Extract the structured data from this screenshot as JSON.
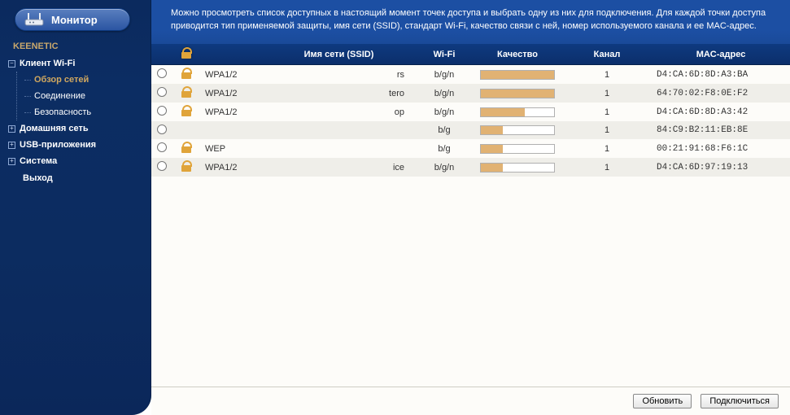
{
  "sidebar": {
    "title": "Монитор",
    "brand": "KEENETIC",
    "items": [
      {
        "label": "Клиент Wi-Fi",
        "expanded": true,
        "children": [
          {
            "label": "Обзор сетей",
            "selected": true
          },
          {
            "label": "Соединение"
          },
          {
            "label": "Безопасность"
          }
        ]
      },
      {
        "label": "Домашняя сеть",
        "expanded": false
      },
      {
        "label": "USB-приложения",
        "expanded": false
      },
      {
        "label": "Система",
        "expanded": false
      }
    ],
    "exit": "Выход"
  },
  "description": "Можно просмотреть список доступных в настоящий момент точек доступа и выбрать одну из них для подключения. Для каждой точки доступа приводится тип применяемой защиты, имя сети (SSID), стандарт Wi-Fi, качество связи с ней, номер используемого канала и ее MAC-адрес.",
  "table": {
    "headers": {
      "radio": "",
      "lock": "",
      "security": "",
      "ssid": "Имя сети (SSID)",
      "wifi": "Wi-Fi",
      "quality": "Качество",
      "channel": "Канал",
      "mac": "MAC-адрес"
    },
    "rows": [
      {
        "locked": true,
        "security": "WPA1/2",
        "ssid": "rs",
        "wifi": "b/g/n",
        "quality": 100,
        "channel": "1",
        "mac": "D4:CA:6D:8D:A3:BA"
      },
      {
        "locked": true,
        "security": "WPA1/2",
        "ssid": "tero",
        "wifi": "b/g/n",
        "quality": 100,
        "channel": "1",
        "mac": "64:70:02:F8:0E:F2"
      },
      {
        "locked": true,
        "security": "WPA1/2",
        "ssid": "op",
        "wifi": "b/g/n",
        "quality": 60,
        "channel": "1",
        "mac": "D4:CA:6D:8D:A3:42"
      },
      {
        "locked": false,
        "security": "",
        "ssid": "",
        "wifi": "b/g",
        "quality": 30,
        "channel": "1",
        "mac": "84:C9:B2:11:EB:8E"
      },
      {
        "locked": true,
        "security": "WEP",
        "ssid": "",
        "wifi": "b/g",
        "quality": 30,
        "channel": "1",
        "mac": "00:21:91:68:F6:1C"
      },
      {
        "locked": true,
        "security": "WPA1/2",
        "ssid": "ice",
        "wifi": "b/g/n",
        "quality": 30,
        "channel": "1",
        "mac": "D4:CA:6D:97:19:13"
      }
    ]
  },
  "buttons": {
    "refresh": "Обновить",
    "connect": "Подключиться"
  }
}
